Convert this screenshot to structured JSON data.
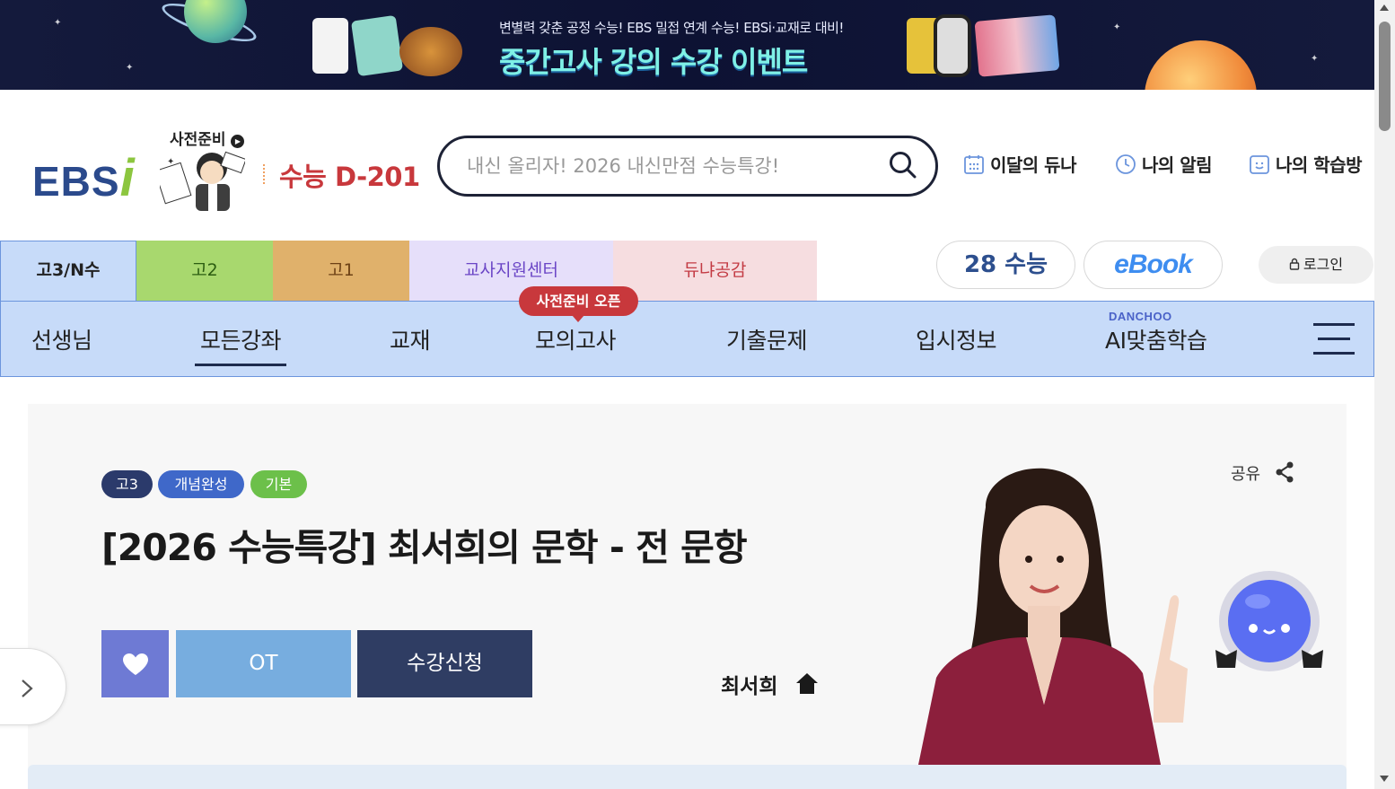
{
  "banner": {
    "subtitle": "변별력 갖춘 공정 수능! EBS 밀접 연계 수능! EBSi·교재로 대비!",
    "title": "중간고사 강의 수강 이벤트"
  },
  "header": {
    "logo_text": "EBS",
    "logo_i": "i",
    "mascot_label": "사전준비",
    "dday": "수능 D-201",
    "search_placeholder": "내신 올리자! 2026 내신만점 수능특강!",
    "util_links": [
      {
        "label": "이달의 듀나",
        "icon": "calendar-icon"
      },
      {
        "label": "나의 알림",
        "icon": "clock-icon"
      },
      {
        "label": "나의 학습방",
        "icon": "smile-icon"
      }
    ]
  },
  "grade_tabs": [
    {
      "label": "고3/N수",
      "active": true
    },
    {
      "label": "고2"
    },
    {
      "label": "고1"
    },
    {
      "label": "교사지원센터"
    },
    {
      "label": "듀냐공감"
    }
  ],
  "quick_links": {
    "suneung": "28 수능",
    "ebook": "eBook",
    "login": "로그인"
  },
  "main_menu": {
    "items": [
      {
        "label": "선생님"
      },
      {
        "label": "모든강좌",
        "active": true
      },
      {
        "label": "교재"
      },
      {
        "label": "모의고사"
      },
      {
        "label": "기출문제"
      },
      {
        "label": "입시정보"
      },
      {
        "label": "AI맞춤학습"
      }
    ],
    "mock_badge": "사전준비 오픈",
    "ai_brand": "DANCHOO"
  },
  "course": {
    "tags": [
      "고3",
      "개념완성",
      "기본"
    ],
    "title": "[2026 수능특강] 최서희의 문학 - 전 문항",
    "ot_label": "OT",
    "apply_label": "수강신청",
    "teacher": "최서희",
    "share_label": "공유"
  },
  "colors": {
    "brand_blue": "#2b4a8c",
    "menu_bg": "#c7dbf9",
    "dday_red": "#c8383c",
    "apply_navy": "#2f3d63",
    "ot_blue": "#77addf",
    "like_purple": "#6e7ad4"
  }
}
